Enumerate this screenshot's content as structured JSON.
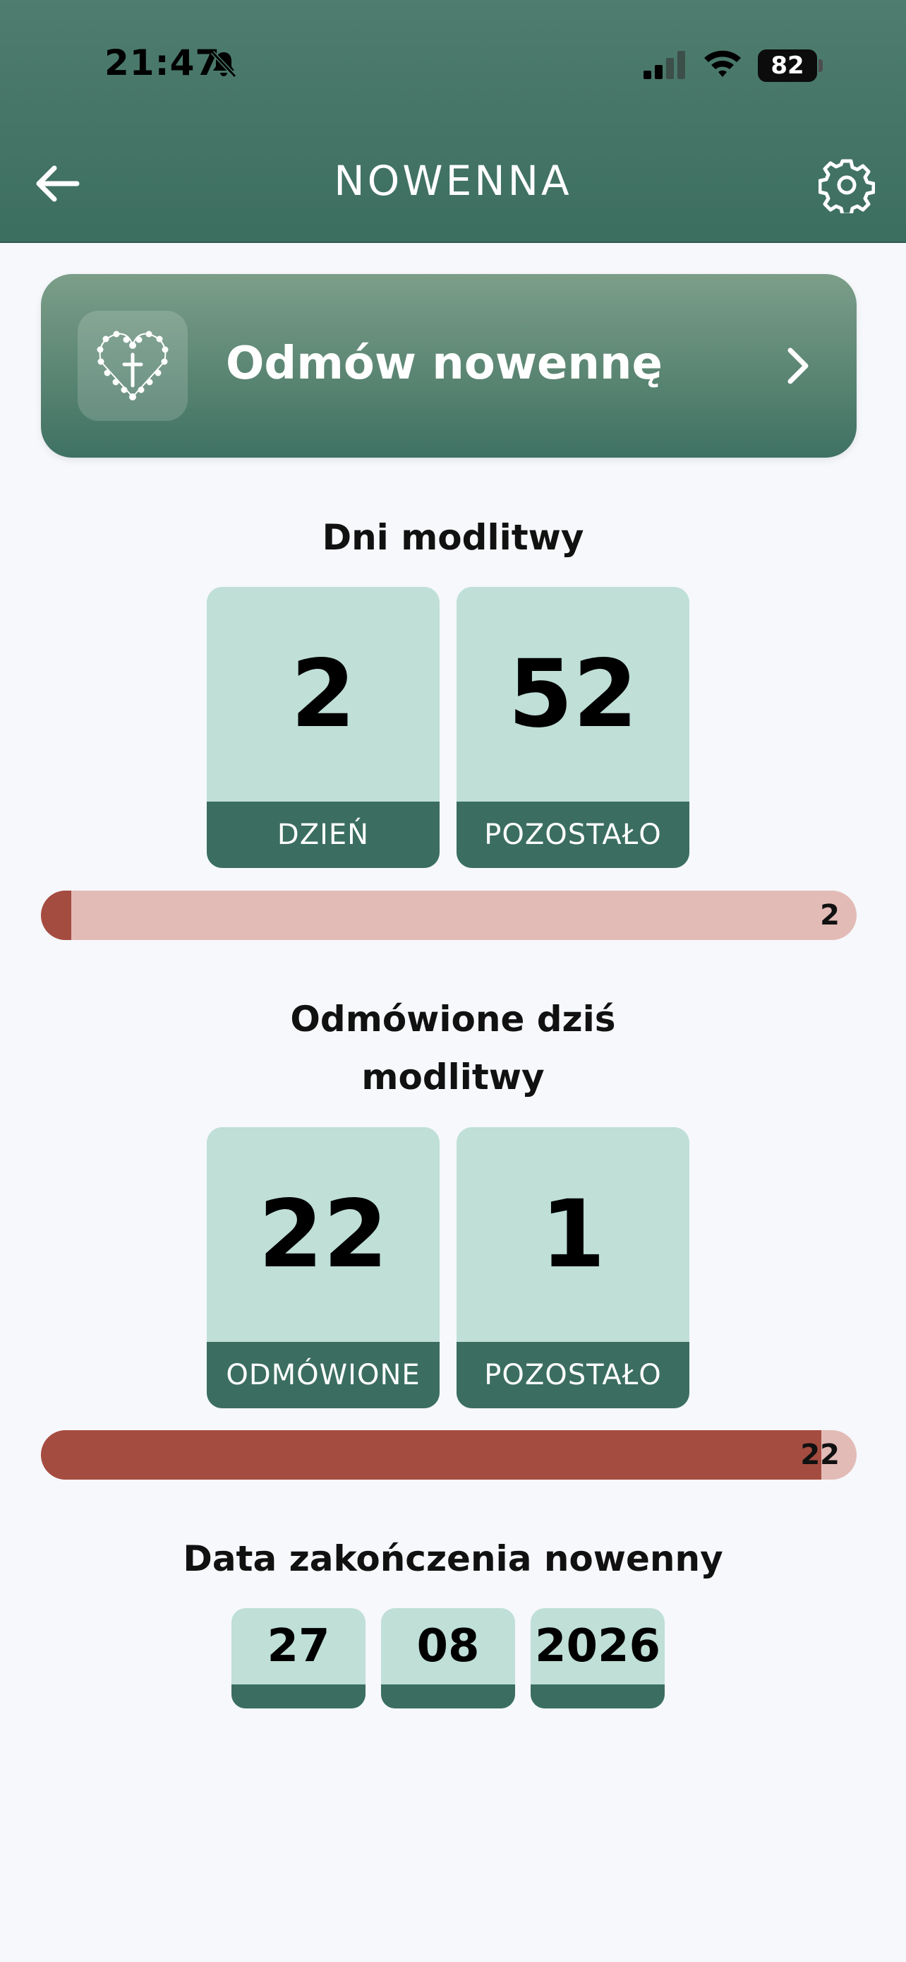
{
  "status_bar": {
    "time": "21:47",
    "battery": "82"
  },
  "header": {
    "title": "NOWENNA"
  },
  "pray_card": {
    "label": "Odmów nowennę"
  },
  "days_section": {
    "title": "Dni modlitwy",
    "day": {
      "value": "2",
      "caption": "DZIEŃ"
    },
    "remaining": {
      "value": "52",
      "caption": "POZOSTAŁO"
    },
    "progress": {
      "fraction": 0.037,
      "label": "2"
    }
  },
  "today_section": {
    "title_line1": "Odmówione dziś",
    "title_line2": "modlitwy",
    "said": {
      "value": "22",
      "caption": "ODMÓWIONE"
    },
    "remaining": {
      "value": "1",
      "caption": "POZOSTAŁO"
    },
    "progress": {
      "fraction": 0.957,
      "label": "22"
    }
  },
  "end_date": {
    "title": "Data zakończenia nowenny",
    "day": "27",
    "month": "08",
    "year": "2026"
  },
  "colors": {
    "header": "#3c6e60",
    "tile_bg": "#bfdfd7",
    "tile_caption": "#3b6e60",
    "progress_track": "#e3bbb6",
    "progress_fill": "#a54c40"
  }
}
